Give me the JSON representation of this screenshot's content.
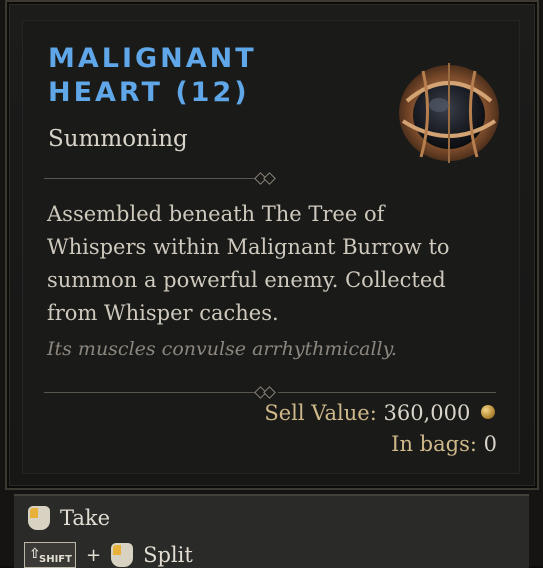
{
  "item": {
    "name_line1": "MALIGNANT",
    "name_line2": "HEART (12)",
    "category": "Summoning",
    "description": "Assembled beneath The Tree of Whispers within Malignant Burrow to summon a powerful enemy. Collected from Whisper caches.",
    "flavor": "Its muscles convulse arrhythmically.",
    "icon": "malignant-heart-icon"
  },
  "stats": {
    "sell_label": "Sell Value:",
    "sell_value": "360,000",
    "bags_label": "In bags:",
    "bags_value": "0"
  },
  "actions": {
    "take_label": "Take",
    "split_label": "Split",
    "shift_key": "SHIFT",
    "plus": "+"
  },
  "colors": {
    "title": "#5fa7e8",
    "accent_gold": "#cfb98a"
  }
}
